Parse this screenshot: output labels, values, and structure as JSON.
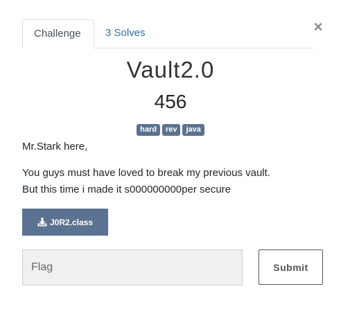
{
  "tabs": [
    {
      "label": "Challenge",
      "active": true
    },
    {
      "label": "3 Solves",
      "active": false
    }
  ],
  "close_symbol": "×",
  "challenge": {
    "name": "Vault2.0",
    "value": "456",
    "tags": [
      "hard",
      "rev",
      "java"
    ],
    "description": [
      "Mr.Stark here,",
      "You guys must have loved to break my previous vault.",
      "But this time i made it s000000000per secure"
    ],
    "file": {
      "name": "J0R2.class",
      "icon": "download-icon"
    }
  },
  "submission": {
    "placeholder": "Flag",
    "value": "",
    "submit_label": "Submit"
  },
  "colors": {
    "tag_bg": "#5b7290",
    "link": "#2f6fab",
    "input_bg": "#f0f0f0"
  }
}
